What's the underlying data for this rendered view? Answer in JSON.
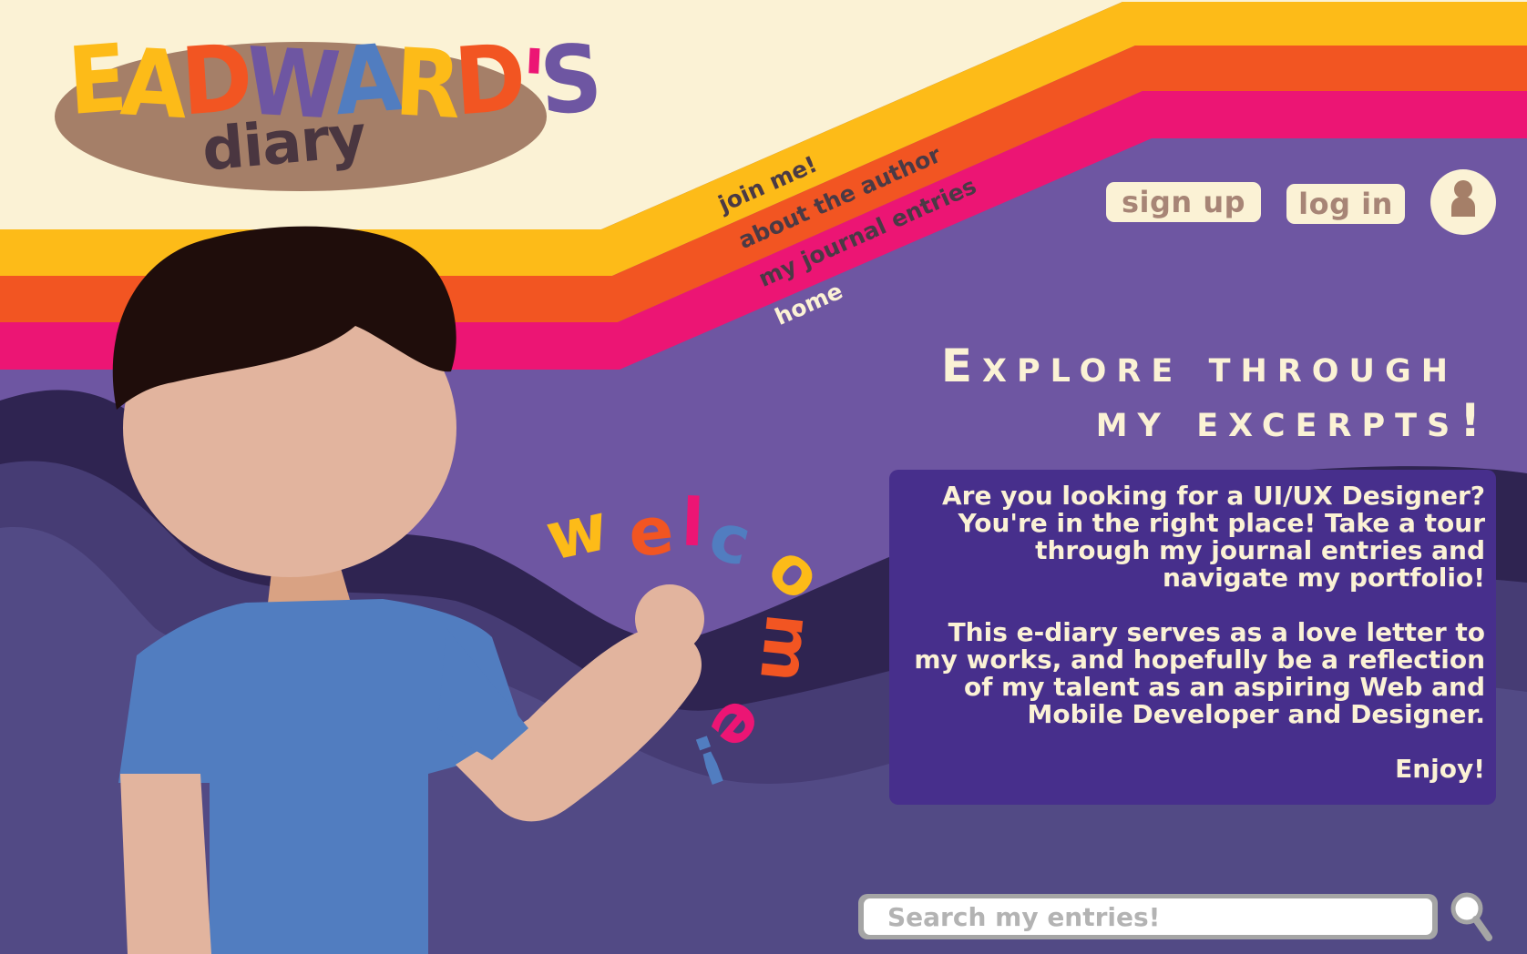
{
  "brand": {
    "logo_text": "EADWARD'S",
    "logo_sub": "diary"
  },
  "nav": {
    "join": "join me!",
    "about": "about the author",
    "journal": "my journal entries",
    "home": "home"
  },
  "auth": {
    "signup": "sign up",
    "login": "log in",
    "profile_icon": "user-icon"
  },
  "hero": {
    "heading_line1": "Explore through",
    "heading_line2": "my excerpts!",
    "intro": "Are you looking for a UI/UX Designer? You're in the right place! Take a tour through my journal entries and navigate my portfolio!",
    "body": "This e-diary serves as a love letter to my works, and hopefully be a reflection of my talent as an aspiring Web and Mobile Developer and Designer.",
    "sign_off": "Enjoy!",
    "welcome": "welcome!"
  },
  "search": {
    "placeholder": "Search my entries!",
    "icon": "magnifier-icon"
  },
  "colors": {
    "cream": "#FBF2D5",
    "yellow": "#FDBB18",
    "orange": "#F25522",
    "magenta": "#EC1574",
    "purple": "#6E56A2",
    "card": "#472F8C",
    "skin": "#E2B49E",
    "shirt": "#517DC0",
    "hair": "#1F0D0B",
    "logo_oval": "#A57F68"
  }
}
